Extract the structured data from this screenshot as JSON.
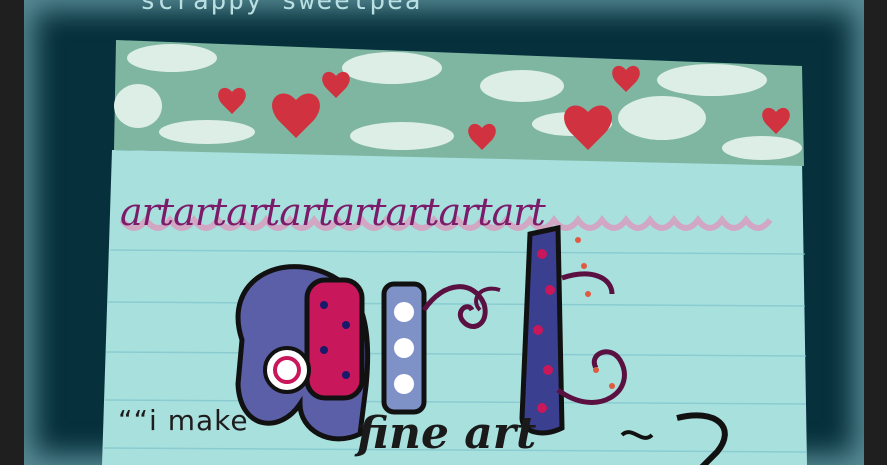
{
  "blog": {
    "title": "scrappy sweetpea"
  },
  "photo": {
    "repeat_text": "artartartartartartartart",
    "headline_word": "art",
    "quote_open": "““i make",
    "fine_art": "fine art"
  },
  "colors": {
    "frame_bg": "#06303b",
    "glow": "#a0dce6",
    "card_bg": "#a8e0de",
    "cloud_band": "#7fb6a2",
    "heart": "#d0323f",
    "ink_purple": "#7c1b69",
    "letter_pink": "#c8175a",
    "letter_blue": "#3a3f8f"
  }
}
